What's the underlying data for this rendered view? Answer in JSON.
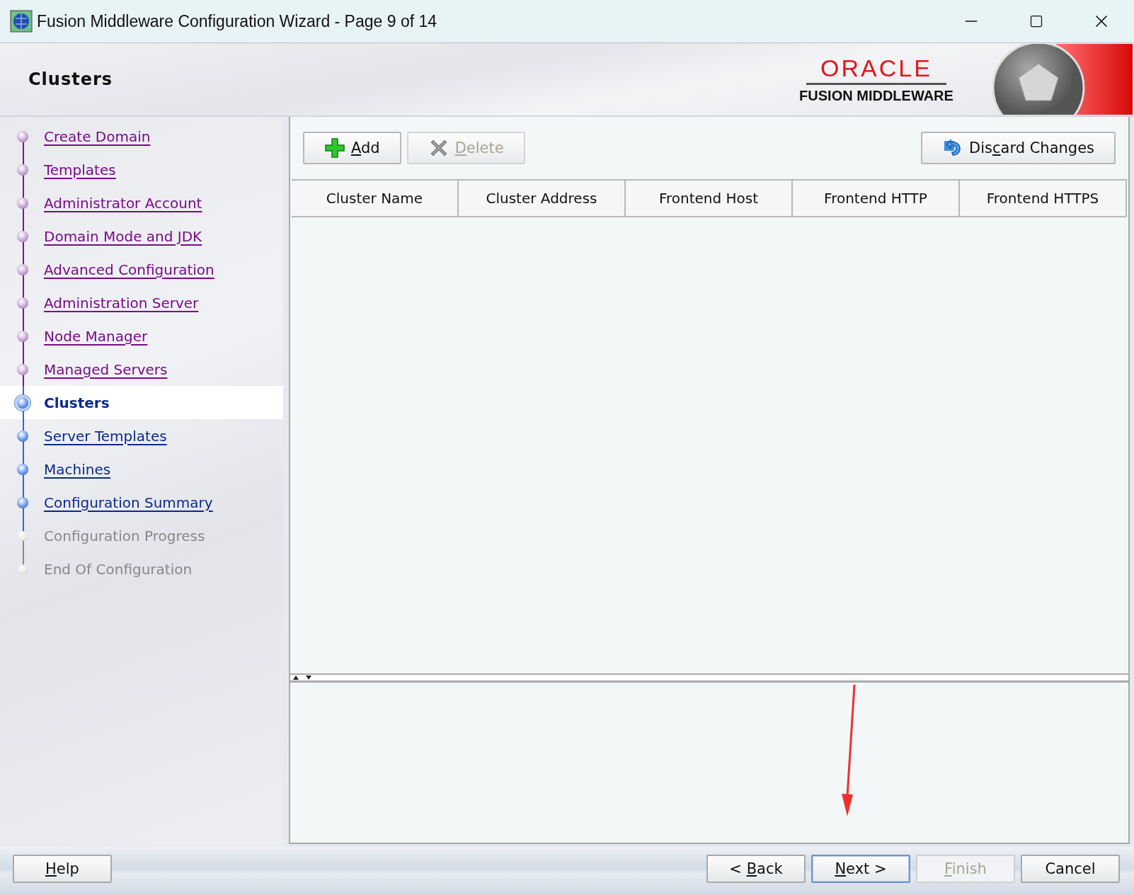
{
  "window": {
    "title": "Fusion Middleware Configuration Wizard - Page 9 of 14"
  },
  "header": {
    "title": "Clusters",
    "brand": "ORACLE",
    "product": "FUSION MIDDLEWARE"
  },
  "steps": [
    {
      "label": "Create Domain",
      "kind": "visited",
      "selected": false
    },
    {
      "label": "Templates",
      "kind": "visited",
      "selected": false
    },
    {
      "label": "Administrator Account",
      "kind": "visited",
      "selected": false
    },
    {
      "label": "Domain Mode and JDK",
      "kind": "visited",
      "selected": false
    },
    {
      "label": "Advanced Configuration",
      "kind": "visited",
      "selected": false
    },
    {
      "label": "Administration Server",
      "kind": "visited",
      "selected": false
    },
    {
      "label": "Node Manager",
      "kind": "visited",
      "selected": false
    },
    {
      "label": "Managed Servers",
      "kind": "visited",
      "selected": false
    },
    {
      "label": "Clusters",
      "kind": "current",
      "selected": true
    },
    {
      "label": "Server Templates",
      "kind": "available",
      "selected": false
    },
    {
      "label": "Machines",
      "kind": "available",
      "selected": false
    },
    {
      "label": "Configuration Summary",
      "kind": "available",
      "selected": false
    },
    {
      "label": "Configuration Progress",
      "kind": "unavailable",
      "selected": false
    },
    {
      "label": "End Of Configuration",
      "kind": "unavailable",
      "selected": false
    }
  ],
  "toolbar": [
    {
      "mnemonic": "A",
      "after": "dd",
      "kind": "add",
      "disabled": false
    },
    {
      "mnemonic": "D",
      "after": "elete",
      "kind": "delete",
      "disabled": true
    }
  ],
  "discard_button": {
    "before": "Dis",
    "mnemonic": "c",
    "after": "ard Changes",
    "kind": "undo",
    "disabled": false
  },
  "table": {
    "columns": [
      "Cluster Name",
      "Cluster Address",
      "Frontend Host",
      "Frontend HTTP",
      "Frontend HTTPS"
    ]
  },
  "footer": {
    "help": {
      "mnemonic": "H",
      "after": "elp",
      "disabled": false,
      "default": false
    },
    "buttons": [
      {
        "before": "< ",
        "mnemonic": "B",
        "after": "ack",
        "disabled": false,
        "default": false
      },
      {
        "mnemonic": "N",
        "after": "ext >",
        "disabled": false,
        "default": true
      },
      {
        "mnemonic": "F",
        "after": "inish",
        "disabled": true,
        "default": false
      },
      {
        "after": "Cancel",
        "disabled": false,
        "default": false
      }
    ]
  }
}
